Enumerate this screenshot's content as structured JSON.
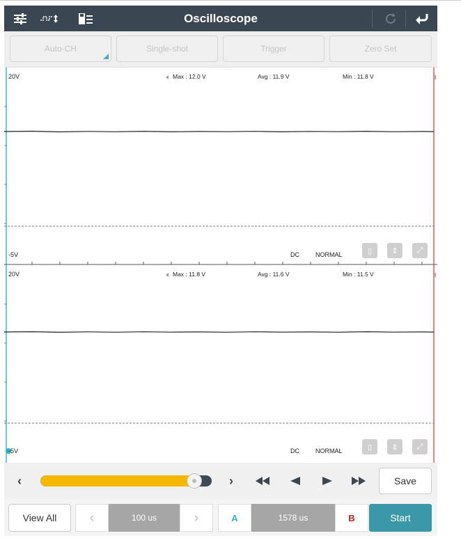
{
  "title": "Oscilloscope",
  "toolbar": {
    "icons": [
      "settings-sliders-icon",
      "waveform-icon",
      "save-list-icon",
      "refresh-icon",
      "back-arrow-icon"
    ]
  },
  "top_buttons": {
    "auto_ch": "Auto-CH",
    "single_shot": "Single-shot",
    "trigger": "Trigger",
    "zero_set": "Zero Set"
  },
  "channels": [
    {
      "top_label": "20V",
      "bottom_label": "-5V",
      "max": "Max : 12.0 V",
      "avg": "Avg : 11.9 V",
      "min": "Min : 11.8 V",
      "coupling": "DC",
      "mode": "NORMAL"
    },
    {
      "top_label": "20V",
      "bottom_label": "-5V",
      "max": "Max : 11.8 V",
      "avg": "Avg : 11.6 V",
      "min": "Min : 11.5 V",
      "coupling": "DC",
      "mode": "NORMAL"
    }
  ],
  "playback": {
    "slider_position": 0.9,
    "save_label": "Save"
  },
  "bottom": {
    "view_all": "View All",
    "timebase": "100 us",
    "cursor_a": "A",
    "cursor_delta": "1578 us",
    "cursor_b": "B",
    "start": "Start"
  },
  "colors": {
    "title_bar": "#3a4752",
    "slider_fill": "#f5b800",
    "start_button": "#3a98a8",
    "cursor_a": "#2bb5c8",
    "cursor_b": "#c22020",
    "left_cursor_line": "#39b6d6",
    "right_cursor_line": "#e05a5a"
  }
}
